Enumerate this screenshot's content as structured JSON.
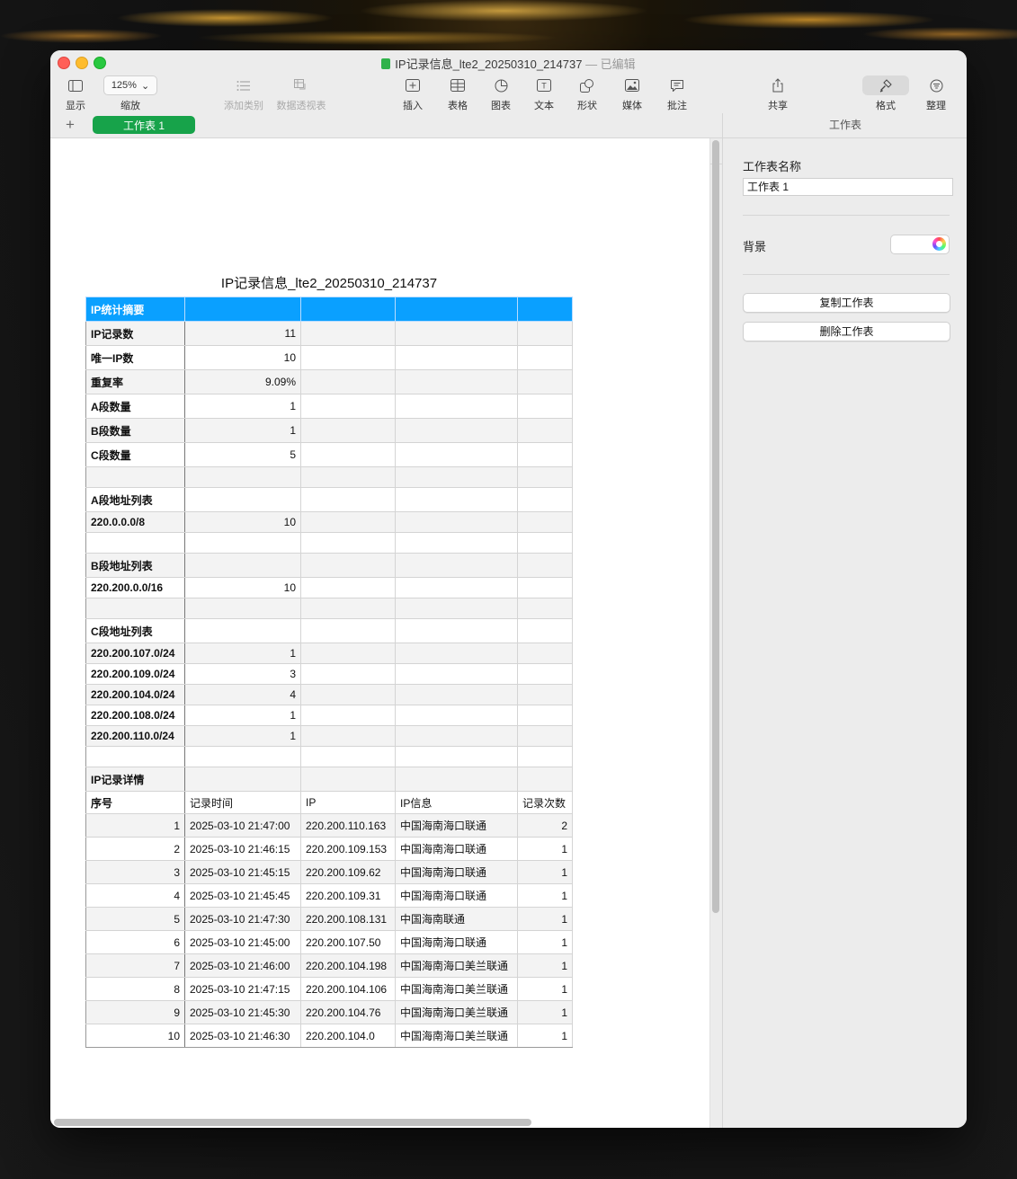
{
  "window": {
    "title": "IP记录信息_lte2_20250310_214737",
    "title_suffix": " — 已编辑"
  },
  "toolbar": {
    "view_label": "显示",
    "zoom_value": "125%",
    "zoom_label": "缩放",
    "add_category_label": "添加类别",
    "pivot_label": "数据透视表",
    "insert_label": "插入",
    "table_label": "表格",
    "chart_label": "图表",
    "text_label": "文本",
    "shape_label": "形状",
    "media_label": "媒体",
    "comment_label": "批注",
    "share_label": "共享",
    "format_label": "格式",
    "organize_label": "整理"
  },
  "tabs": {
    "add_symbol": "+",
    "active_sheet": "工作表 1"
  },
  "sheet": {
    "title": "IP记录信息_lte2_20250310_214737",
    "summary_header": "IP统计摘要",
    "summary": [
      {
        "label": "IP记录数",
        "value": "11"
      },
      {
        "label": "唯一IP数",
        "value": "10"
      },
      {
        "label": "重复率",
        "value": "9.09%"
      },
      {
        "label": "A段数量",
        "value": "1"
      },
      {
        "label": "B段数量",
        "value": "1"
      },
      {
        "label": "C段数量",
        "value": "5"
      }
    ],
    "a_section_title": "A段地址列表",
    "a_rows": [
      {
        "label": "220.0.0.0/8",
        "value": "10"
      }
    ],
    "b_section_title": "B段地址列表",
    "b_rows": [
      {
        "label": "220.200.0.0/16",
        "value": "10"
      }
    ],
    "c_section_title": "C段地址列表",
    "c_rows": [
      {
        "label": "220.200.107.0/24",
        "value": "1"
      },
      {
        "label": "220.200.109.0/24",
        "value": "3"
      },
      {
        "label": "220.200.104.0/24",
        "value": "4"
      },
      {
        "label": "220.200.108.0/24",
        "value": "1"
      },
      {
        "label": "220.200.110.0/24",
        "value": "1"
      }
    ],
    "detail_title": "IP记录详情",
    "detail_headers": [
      "序号",
      "记录时间",
      "IP",
      "IP信息",
      "记录次数"
    ],
    "detail_rows": [
      [
        "1",
        "2025-03-10 21:47:00",
        "220.200.110.163",
        "中国海南海口联通",
        "2"
      ],
      [
        "2",
        "2025-03-10 21:46:15",
        "220.200.109.153",
        "中国海南海口联通",
        "1"
      ],
      [
        "3",
        "2025-03-10 21:45:15",
        "220.200.109.62",
        "中国海南海口联通",
        "1"
      ],
      [
        "4",
        "2025-03-10 21:45:45",
        "220.200.109.31",
        "中国海南海口联通",
        "1"
      ],
      [
        "5",
        "2025-03-10 21:47:30",
        "220.200.108.131",
        "中国海南联通",
        "1"
      ],
      [
        "6",
        "2025-03-10 21:45:00",
        "220.200.107.50",
        "中国海南海口联通",
        "1"
      ],
      [
        "7",
        "2025-03-10 21:46:00",
        "220.200.104.198",
        "中国海南海口美兰联通",
        "1"
      ],
      [
        "8",
        "2025-03-10 21:47:15",
        "220.200.104.106",
        "中国海南海口美兰联通",
        "1"
      ],
      [
        "9",
        "2025-03-10 21:45:30",
        "220.200.104.76",
        "中国海南海口美兰联通",
        "1"
      ],
      [
        "10",
        "2025-03-10 21:46:30",
        "220.200.104.0",
        "中国海南海口美兰联通",
        "1"
      ]
    ]
  },
  "panel": {
    "header": "工作表",
    "name_label": "工作表名称",
    "name_value": "工作表 1",
    "background_label": "背景",
    "duplicate_button": "复制工作表",
    "delete_button": "删除工作表"
  },
  "colors": {
    "header_fill": "#0aa0ff",
    "sheet_tab": "#17a34a"
  }
}
